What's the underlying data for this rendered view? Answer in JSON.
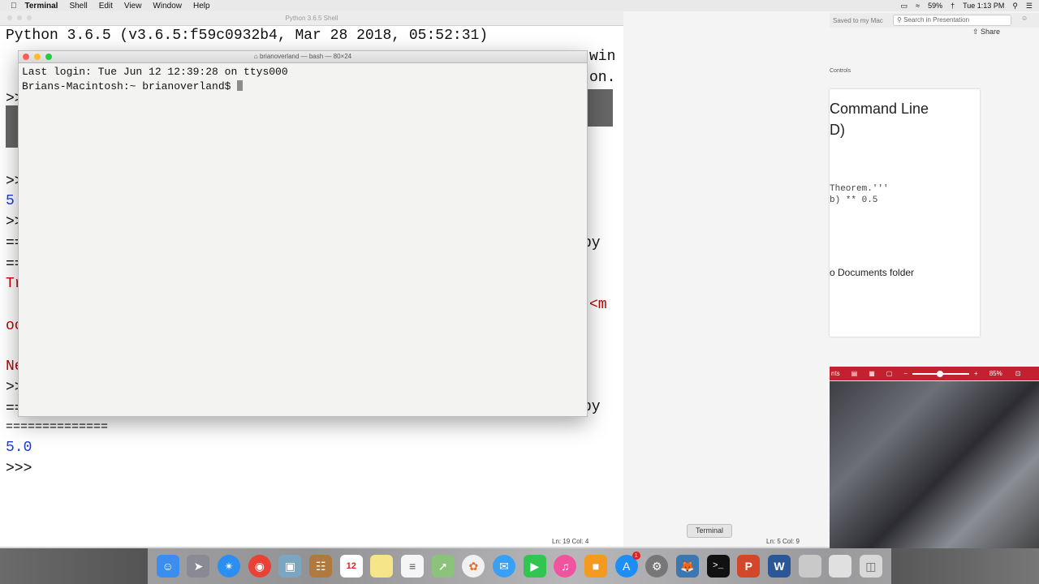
{
  "menubar": {
    "app": "Terminal",
    "items": [
      "Shell",
      "Edit",
      "View",
      "Window",
      "Help"
    ],
    "battery": "59%",
    "clock": "Tue 1:13 PM"
  },
  "shell_window": {
    "title": "Python 3.6.5 Shell",
    "line1": "Python 3.6.5 (v3.6.5:f59c0932b4, Mar 28 2018, 05:52:31)",
    "right_frag1": "win",
    "right_frag2": "on.",
    "prompt_frag": ">>",
    "val_5": "5",
    "equals_frag": "==",
    "tr_frag": "Tr",
    "oc_frag": "oc",
    "ne_frag": "Ne",
    "py_frag": "py",
    "lt_m_frag": "<m",
    "equals_line": "==============",
    "result": "5.0",
    "last_prompt": ">>>",
    "status": "Ln: 19   Col: 4"
  },
  "terminal": {
    "title": "brianoverland — bash — 80×24",
    "line1": "Last login: Tue Jun 12 12:39:28 on ttys000",
    "line2": "Brians-Macintosh:~ brianoverland$ "
  },
  "ppt": {
    "saved": "Saved to my Mac",
    "search_placeholder": "Search in Presentation",
    "share": "Share",
    "controls": "Controls",
    "slide_title1": "Command Line",
    "slide_title2": "D)",
    "code1": "Theorem.'''",
    "code2": "b) ** 0.5",
    "docs": "o Documents folder",
    "red_left": "nts",
    "zoom": "85%",
    "status": "Ln: 5   Col: 9"
  },
  "dock": {
    "tooltip": "Terminal",
    "calendar_day": "12",
    "badge": "1",
    "icons": [
      "finder-icon",
      "launchpad-icon",
      "safari-icon",
      "chrome-icon",
      "preview-icon",
      "contacts-icon",
      "calendar-icon",
      "notes-icon",
      "reminders-icon",
      "maps-icon",
      "photos-icon",
      "messages-icon",
      "facetime-icon",
      "itunes-icon",
      "ibooks-icon",
      "appstore-icon",
      "system-preferences-icon",
      "python-icon",
      "terminal-icon",
      "powerpoint-icon",
      "word-icon",
      "downloads-icon",
      "documents-icon",
      "trash-icon"
    ]
  }
}
